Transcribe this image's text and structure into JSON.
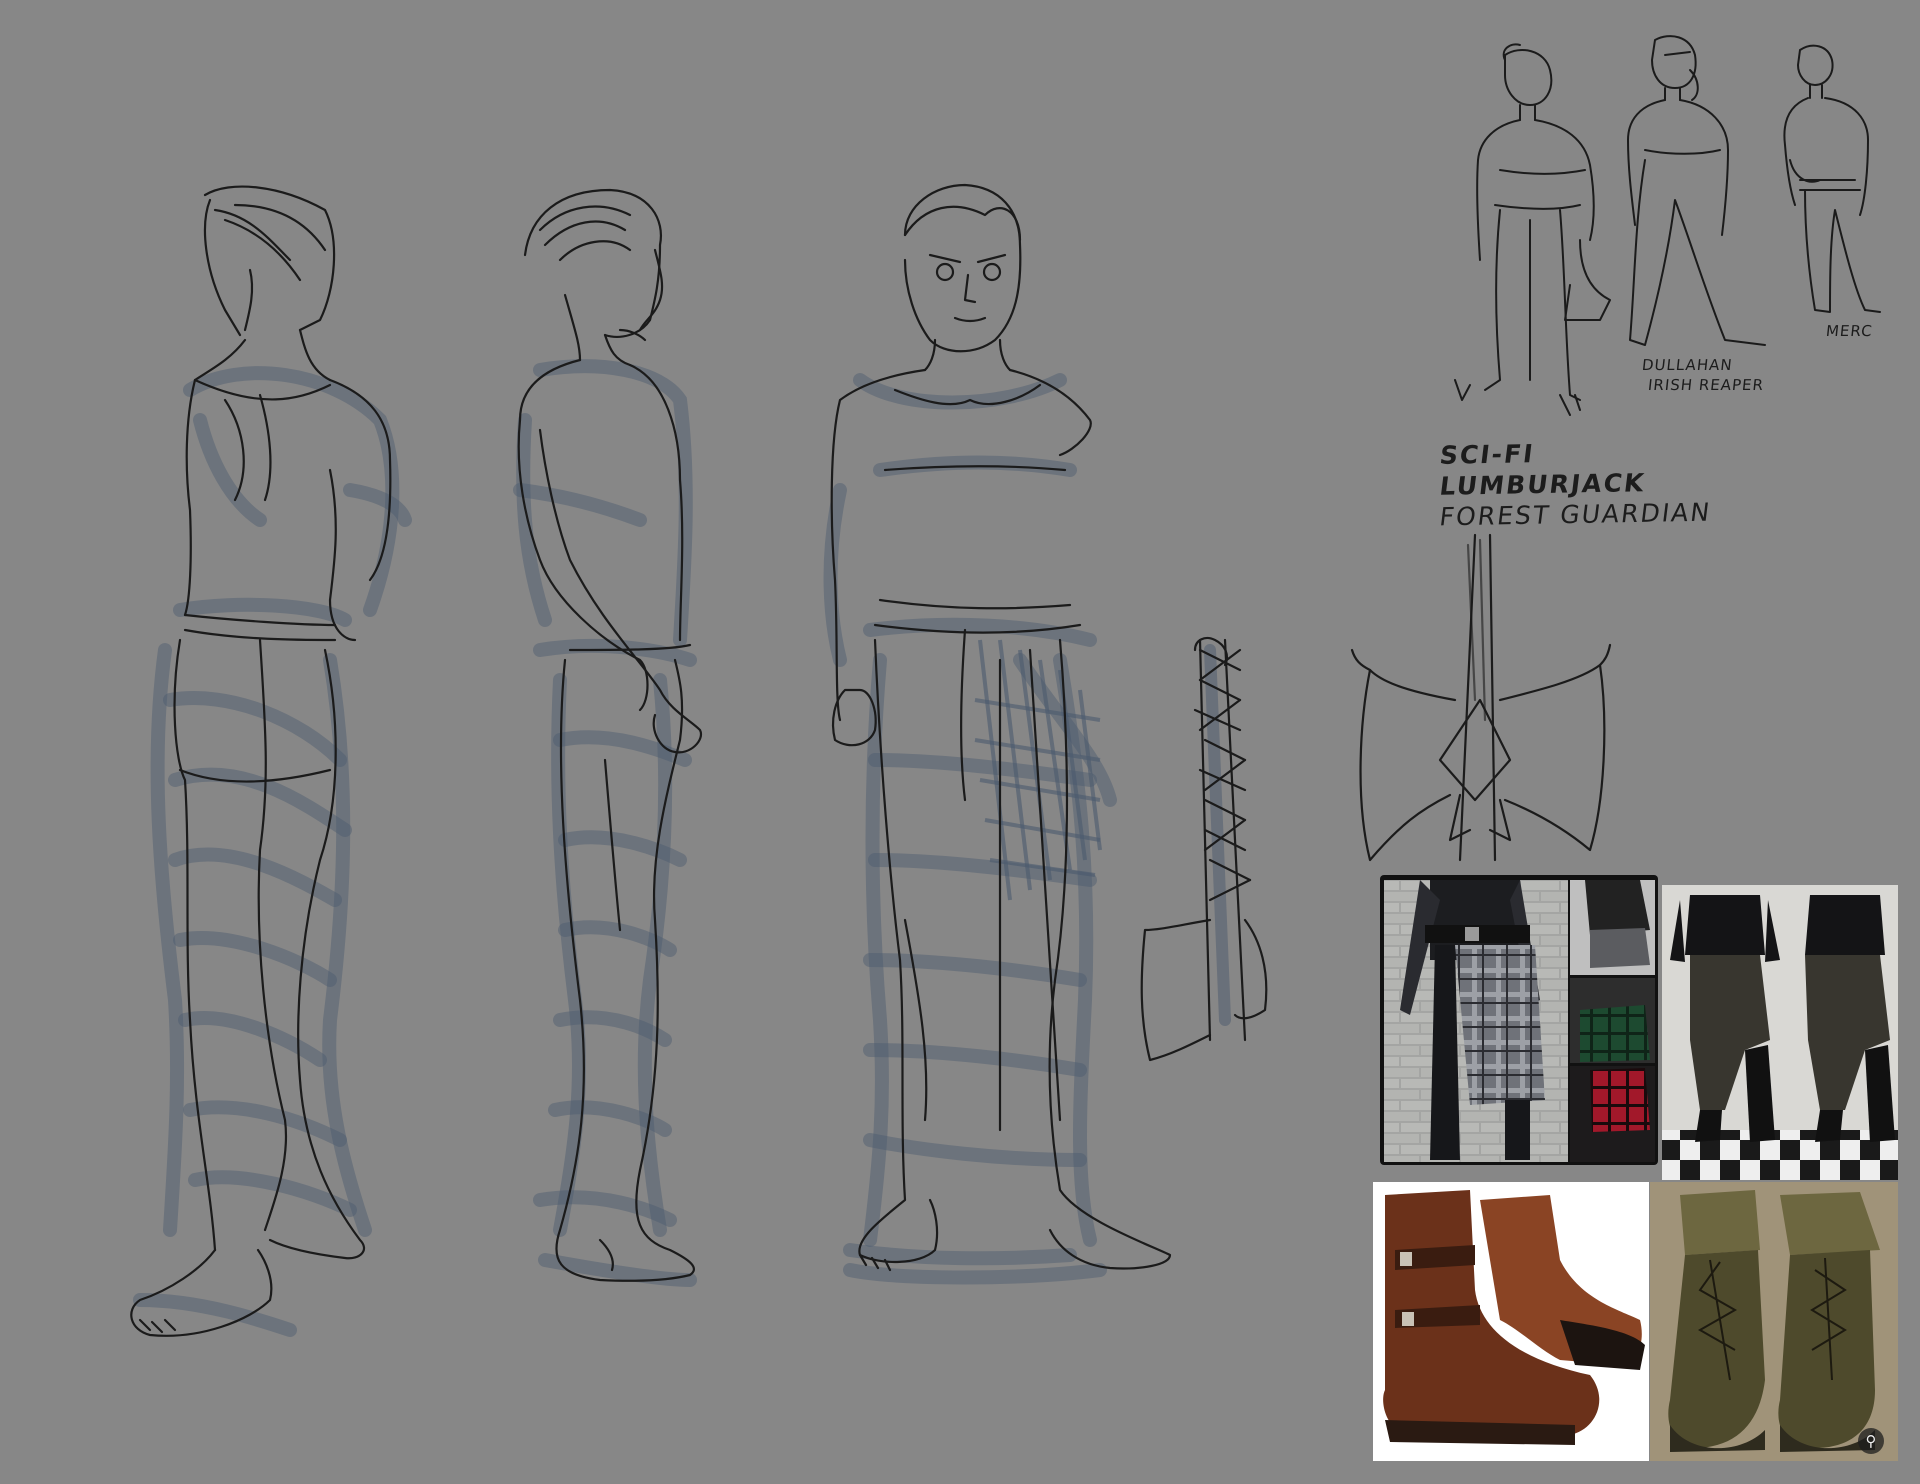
{
  "colors": {
    "background": "#878787",
    "ink": "#1b1b1b",
    "marker": "#4b5a6e"
  },
  "notes": {
    "merc": "MERC",
    "dullahan_line1": "DULLAHAN",
    "dullahan_line2": "IRISH REAPER",
    "scifi": "SCI-FI",
    "lumberjack": "LUMBURJACK",
    "forest_guardian": "FOREST GUARDIAN"
  },
  "reference_images": [
    {
      "name": "kilt-outfits-collage",
      "palette": [
        "#2a2a2e",
        "#7d7f86",
        "#9ea0a3",
        "#1f5a3a",
        "#a31a2a"
      ]
    },
    {
      "name": "cargo-pants-pair",
      "palette": [
        "#1a1a1c",
        "#3b3a37",
        "#d8d8d6",
        "#222222"
      ]
    },
    {
      "name": "brown-leather-boots",
      "palette": [
        "#5a2a14",
        "#8a4424",
        "#2a1a12",
        "#ffffff"
      ]
    },
    {
      "name": "olive-lace-up-boots",
      "palette": [
        "#4e4a2c",
        "#6d6740",
        "#8a7a63",
        "#a79a83"
      ]
    }
  ],
  "icons": {
    "zoom_icon": "magnifier"
  }
}
